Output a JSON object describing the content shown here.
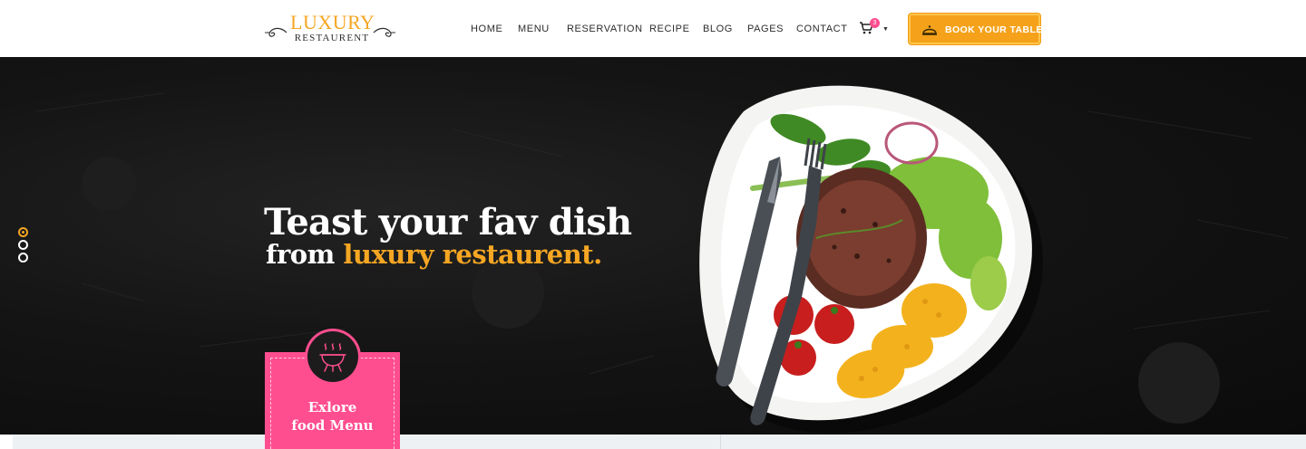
{
  "logo": {
    "top": "LUXURY",
    "bottom": "RESTAURENT"
  },
  "nav": {
    "items": [
      "HOME",
      "MENU",
      "RESERVATION",
      "RECIPE",
      "BLOG",
      "PAGES",
      "CONTACT"
    ]
  },
  "cart": {
    "count": "3",
    "icon": "cart-icon"
  },
  "book_button": {
    "label": "BOOK YOUR TABLE",
    "icon": "serving-cloche-icon"
  },
  "hero": {
    "title": "Teast your fav dish",
    "sub_prefix": "from ",
    "sub_accent": "luxury restaurent.",
    "slides": {
      "count": 3,
      "active": 1
    }
  },
  "explore": {
    "line1": "Exlore",
    "line2": "food Menu",
    "icon": "grill-icon"
  },
  "colors": {
    "accent": "#f5a623",
    "pink": "#ff4e8f",
    "dark": "#111111"
  }
}
